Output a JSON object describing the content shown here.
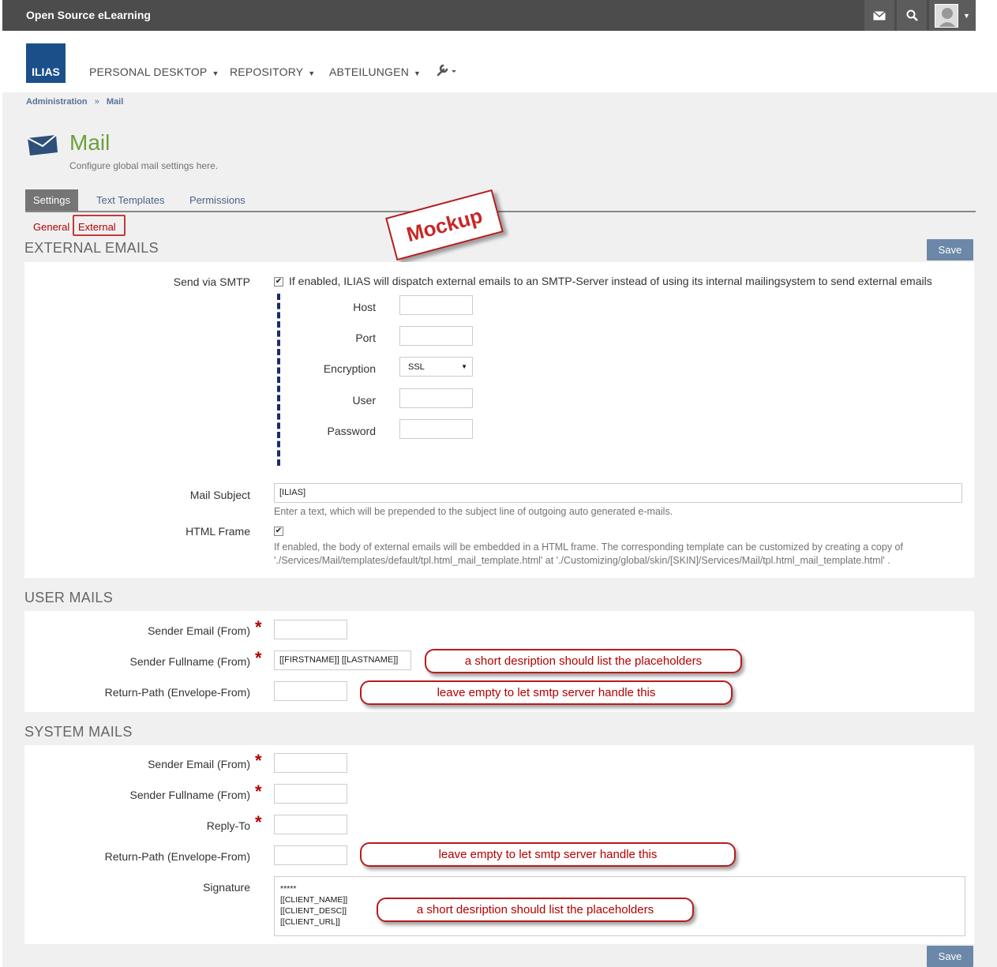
{
  "topbar": {
    "brand": "Open Source eLearning",
    "icons": [
      "mail-icon",
      "search-icon",
      "avatar"
    ]
  },
  "header": {
    "logo": "ILIAS",
    "nav": [
      "PERSONAL DESKTOP",
      "REPOSITORY",
      "ABTEILUNGEN"
    ],
    "tools_icon": "wrench-icon"
  },
  "breadcrumb": {
    "items": [
      "Administration",
      "Mail"
    ],
    "separator": "»"
  },
  "page": {
    "title": "Mail",
    "description": "Configure global mail settings here.",
    "icon": "envelope-icon"
  },
  "tabs": [
    "Settings",
    "Text Templates",
    "Permissions"
  ],
  "subtabs": [
    "General",
    "External"
  ],
  "mockup_stamp": "Mockup",
  "external": {
    "title": "EXTERNAL EMAILS",
    "save": "Save",
    "smtp_label": "Send via SMTP",
    "smtp_checked": true,
    "smtp_text": "If enabled, ILIAS will dispatch external emails to an SMTP-Server instead of using its internal mailingsystem to send external emails",
    "host_label": "Host",
    "port_label": "Port",
    "encryption_label": "Encryption",
    "encryption_value": "SSL",
    "user_label": "User",
    "password_label": "Password",
    "subject_label": "Mail Subject",
    "subject_value": "[ILIAS]",
    "subject_help": "Enter a text, which will be prepended to the subject line of outgoing auto generated e-mails.",
    "frame_label": "HTML Frame",
    "frame_checked": true,
    "frame_help_1": "If enabled, the body of external emails will be embedded in a HTML frame. The corresponding template can be customized by creating a copy of",
    "frame_help_2": "'./Services/Mail/templates/default/tpl.html_mail_template.html' at './Customizing/global/skin/[SKIN]/Services/Mail/tpl.html_mail_template.html' ."
  },
  "user_mails": {
    "title": "USER MAILS",
    "sender_email_label": "Sender Email (From)",
    "sender_fullname_label": "Sender Fullname (From)",
    "sender_fullname_value": "[[FIRSTNAME]] [[LASTNAME]]",
    "return_path_label": "Return-Path (Envelope-From)",
    "note_placeholders": "a short desription should list the placeholders",
    "note_return": "leave empty to let smtp server handle this"
  },
  "system_mails": {
    "title": "SYSTEM MAILS",
    "sender_email_label": "Sender Email (From)",
    "sender_fullname_label": "Sender Fullname (From)",
    "reply_to_label": "Reply-To",
    "return_path_label": "Return-Path (Envelope-From)",
    "signature_label": "Signature",
    "signature_lines": [
      "*****",
      "[[CLIENT_NAME]]",
      "[[CLIENT_DESC]]",
      "[[CLIENT_URL]]"
    ],
    "note_return": "leave empty to let smtp server handle this",
    "note_placeholders": "a short desription should list the placeholders",
    "save": "Save"
  },
  "colors": {
    "topbar": "#4c4c4c",
    "logo": "#1b4f8a",
    "title": "#6ea03c",
    "required": "#b30000",
    "save": "#6c88a8",
    "callout": "#b71c1c"
  }
}
